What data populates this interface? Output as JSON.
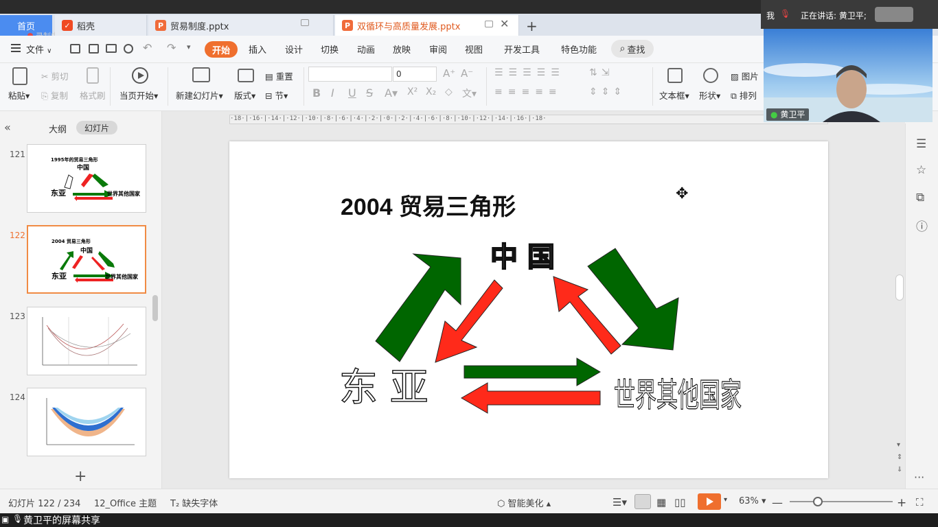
{
  "tabs": {
    "home": "首页",
    "docs": [
      {
        "label": "稻壳",
        "icon": "daoke-icon"
      },
      {
        "label": "贸易制度.pptx",
        "icon": "ppt-icon"
      },
      {
        "label": "双循环与高质量发展.pptx",
        "icon": "ppt-icon"
      }
    ],
    "recording": "录制中"
  },
  "menu": {
    "file": "文件",
    "items": [
      "开始",
      "插入",
      "设计",
      "切换",
      "动画",
      "放映",
      "审阅",
      "视图",
      "开发工具",
      "特色功能"
    ],
    "find": "查找"
  },
  "ribbon": {
    "paste": "粘贴",
    "cut": "剪切",
    "copy": "复制",
    "format_painter": "格式刷",
    "play_current": "当页开始",
    "new_slide": "新建幻灯片",
    "layout": "版式",
    "reset": "重置",
    "section": "节",
    "font_size": "0",
    "textbox": "文本框",
    "shape": "形状",
    "picture": "图片",
    "arrange": "排列"
  },
  "left_pane": {
    "outline_tab": "大纲",
    "slides_tab": "幻灯片",
    "thumbs": [
      {
        "num": "121",
        "title": "1995年的贸易三角形"
      },
      {
        "num": "122",
        "title": "2004 贸易三角形"
      },
      {
        "num": "123",
        "title": ""
      },
      {
        "num": "124",
        "title": ""
      }
    ]
  },
  "slide": {
    "title": "2004 贸易三角形",
    "china": "中 国",
    "east_asia": "东 亚",
    "rest_of_world": "世界其他国家",
    "colors": {
      "green": "#006600",
      "red": "#ff2a1a"
    }
  },
  "ruler_text": "·18·|·16·|·14·|·12·|·10·|·8·|·6·|·4·|·2·|·0·|·2·|·4·|·6·|·8·|·10·|·12·|·14·|·16·|·18·",
  "status": {
    "slide_info": "幻灯片 122 / 234",
    "theme": "12_Office 主题",
    "missing_font": "缺失字体",
    "beautify": "智能美化",
    "zoom": "63%"
  },
  "share_bar": "黄卫平的屏幕共享",
  "video": {
    "me": "我",
    "speaking": "正在讲话: 黄卫平;",
    "name": "黄卫平"
  }
}
